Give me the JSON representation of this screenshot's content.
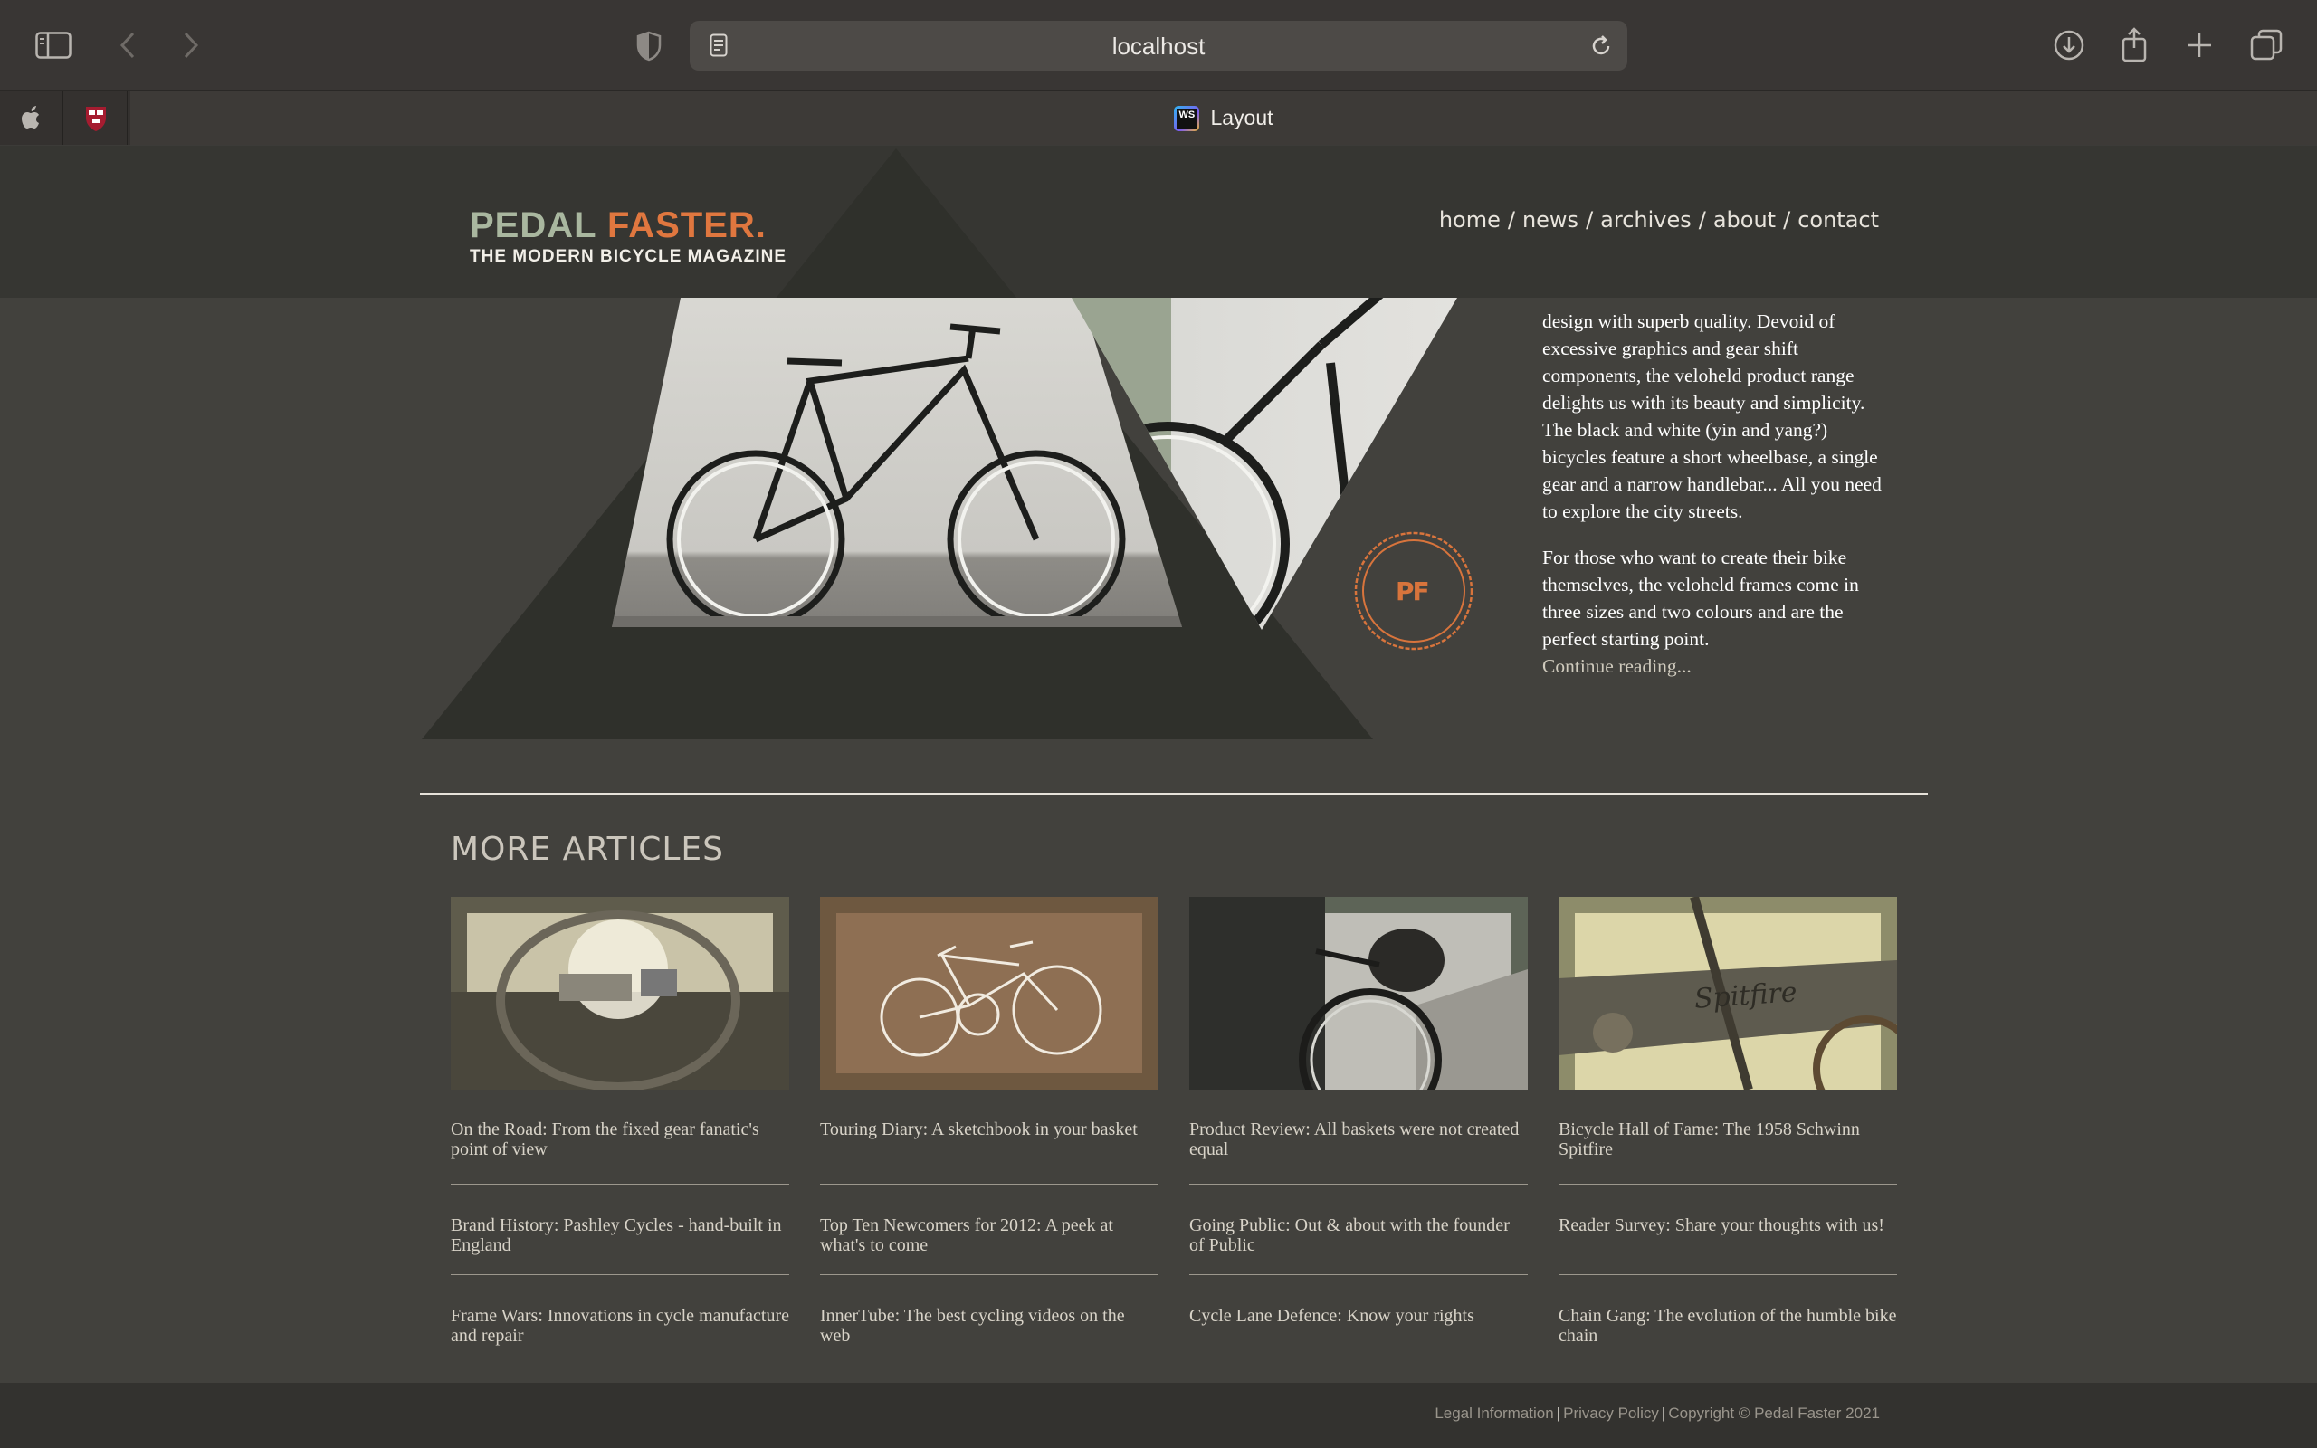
{
  "browser": {
    "url": "localhost",
    "tab_title": "Layout",
    "tab_favicon_text": "WS"
  },
  "site": {
    "logo_part1": "PEDAL",
    "logo_part2": "FASTER.",
    "tagline": "THE MODERN BICYCLE MAGAZINE",
    "nav": [
      "home",
      "news",
      "archives",
      "about",
      "contact"
    ],
    "badge_text": "PF"
  },
  "featured": {
    "paragraph1": "design with superb quality. Devoid of excessive graphics and gear shift components, the veloheld product range delights us with its beauty and simplicity. The black and white (yin and yang?) bicycles feature a short wheelbase, a single gear and a narrow handlebar... All you need to explore the city streets.",
    "paragraph2": "For those who want to create their bike themselves, the veloheld frames come in three sizes and two colours and are the perfect starting point.",
    "continue_link": "Continue reading..."
  },
  "more_articles": {
    "heading": "MORE ARTICLES",
    "columns": [
      {
        "thumb": "fixed-gear-road-photo",
        "links": [
          "On the Road: From the fixed gear fanatic's point of view",
          "Brand History: Pashley Cycles - hand-built in England",
          "Frame Wars: Innovations in cycle manufacture and repair"
        ]
      },
      {
        "thumb": "bicycle-sketch",
        "links": [
          "Touring Diary: A sketchbook in your basket",
          "Top Ten Newcomers for 2012: A peek at what's to come",
          "InnerTube: The best cycling videos on the web"
        ]
      },
      {
        "thumb": "bike-basket-photo",
        "links": [
          "Product Review: All baskets were not created equal",
          "Going Public: Out & about with the founder of Public",
          "Cycle Lane Defence: Know your rights"
        ]
      },
      {
        "thumb": "schwinn-spitfire-photo",
        "links": [
          "Bicycle Hall of Fame: The 1958 Schwinn Spitfire",
          "Reader Survey: Share your thoughts with us!",
          "Chain Gang: The evolution of the humble bike chain"
        ]
      }
    ]
  },
  "footer": {
    "legal": "Legal Information",
    "privacy": "Privacy Policy",
    "copyright": "Copyright © Pedal Faster 2021"
  },
  "colors": {
    "accent_orange": "#e0773f",
    "logo_green": "#a9b79f",
    "page_bg": "#42413d",
    "header_bg": "#363632"
  }
}
